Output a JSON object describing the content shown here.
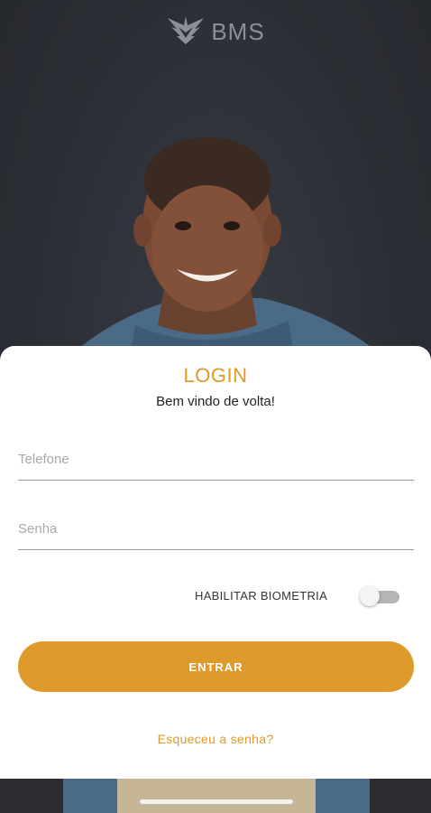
{
  "header": {
    "brand": "BMS",
    "logo_icon": "eagle-logo-icon"
  },
  "hero": {
    "image": "smiling-man-photo"
  },
  "login": {
    "title": "LOGIN",
    "subtitle": "Bem vindo de volta!",
    "phone_placeholder": "Telefone",
    "password_placeholder": "Senha",
    "biometry_label": "HABILITAR BIOMETRIA",
    "biometry_enabled": false,
    "submit_label": "ENTRAR",
    "forgot_label": "Esqueceu a senha?"
  },
  "colors": {
    "accent": "#df9a2c",
    "background": "#2e3037"
  }
}
